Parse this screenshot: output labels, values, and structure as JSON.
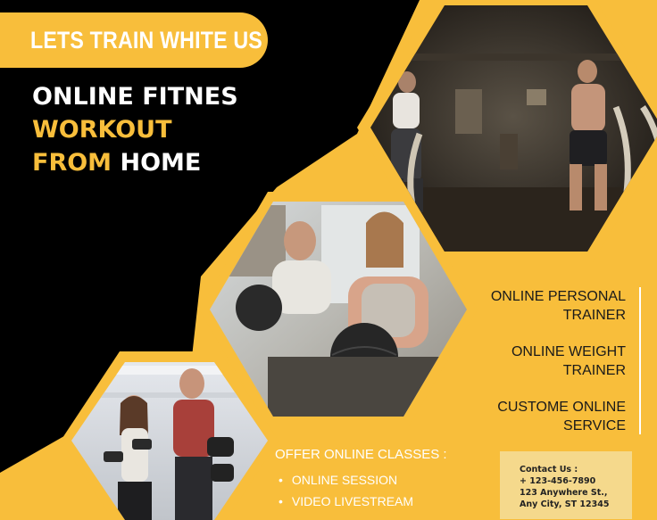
{
  "brand": {
    "tagline": "LETS TRAIN WHITE US",
    "colors": {
      "accent": "#f8be3b",
      "dark": "#000000",
      "contact_panel": "#f5d98c"
    }
  },
  "headline": {
    "line1": "ONLINE FITNES",
    "line2": "WORKOUT",
    "line3_accent": "FROM",
    "line3_plain": "HOME"
  },
  "photos": [
    {
      "name": "battle-ropes-photo",
      "description_icon": "gym-training-icon"
    },
    {
      "name": "medicine-ball-photo",
      "description_icon": "fitness-class-icon"
    },
    {
      "name": "dumbbell-photo",
      "description_icon": "dumbbell-icon"
    }
  ],
  "services": [
    {
      "line1": "ONLINE PERSONAL",
      "line2": "TRAINER"
    },
    {
      "line1": "ONLINE WEIGHT",
      "line2": "TRAINER"
    },
    {
      "line1": "CUSTOME ONLINE",
      "line2": "SERVICE"
    }
  ],
  "offer": {
    "heading": "OFFER ONLINE CLASSES :",
    "items": [
      "ONLINE SESSION",
      "VIDEO LIVESTREAM"
    ]
  },
  "contact": {
    "label": "Contact Us :",
    "phone": "+ 123-456-7890",
    "street": "123 Anywhere St.,",
    "city": "Any City, ST 12345"
  }
}
